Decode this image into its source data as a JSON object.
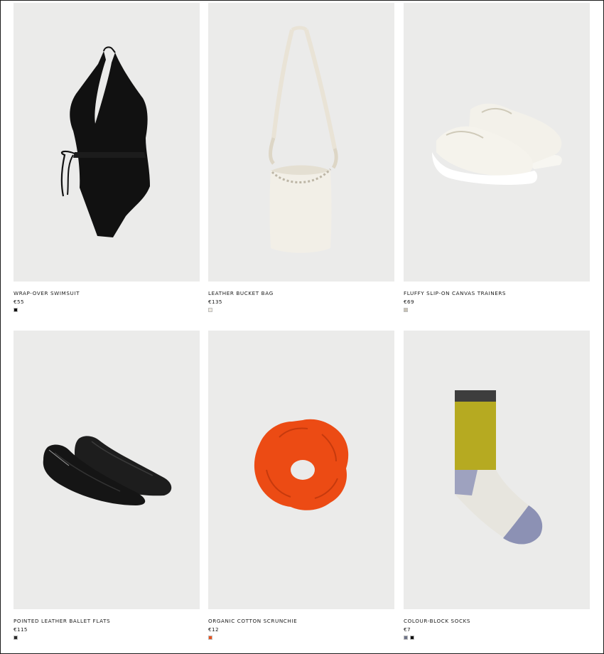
{
  "products": [
    {
      "name": "WRAP-OVER SWIMSUIT",
      "price": "€55",
      "icon": "swimsuit-image",
      "swatches": [
        "#111111"
      ]
    },
    {
      "name": "LEATHER BUCKET BAG",
      "price": "€135",
      "icon": "bucket-bag-image",
      "swatches": [
        "#efeae0"
      ]
    },
    {
      "name": "FLUFFY SLIP-ON CANVAS TRAINERS",
      "price": "€69",
      "icon": "trainers-image",
      "swatches": [
        "#c9c3b4"
      ]
    },
    {
      "name": "POINTED LEATHER BALLET FLATS",
      "price": "€115",
      "icon": "ballet-flats-image",
      "swatches": [
        "#2b2b2b"
      ]
    },
    {
      "name": "ORGANIC COTTON SCRUNCHIE",
      "price": "€12",
      "icon": "scrunchie-image",
      "swatches": [
        "#e8531f"
      ]
    },
    {
      "name": "COLOUR-BLOCK SOCKS",
      "price": "€7",
      "icon": "socks-image",
      "swatches": [
        "#6e7388",
        "#111111"
      ]
    }
  ]
}
